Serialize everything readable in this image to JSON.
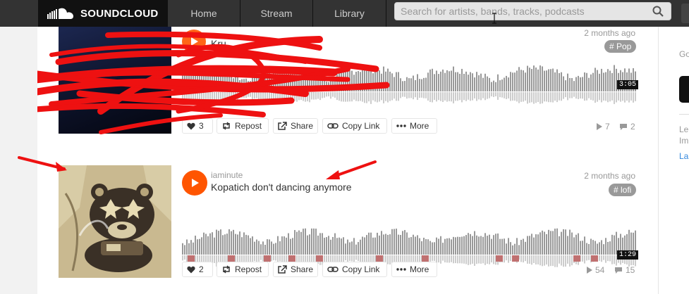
{
  "header": {
    "logo_text": "SOUNDCLOUD",
    "nav": [
      "Home",
      "Stream",
      "Library"
    ],
    "search_placeholder": "Search for artists, bands, tracks, podcasts"
  },
  "colors": {
    "accent": "#ff5500",
    "annotation": "#ee1111"
  },
  "tracks": [
    {
      "title": "Kru...",
      "posted": "2 months ago",
      "tag": "# Pop",
      "duration": "3:05",
      "likes": "3",
      "plays": "7",
      "comments": "2"
    },
    {
      "artist": "iaminute",
      "title": "Kopatich don't dancing anymore",
      "posted": "2 months ago",
      "tag": "# lofi",
      "duration": "1:29",
      "likes": "2",
      "plays": "54",
      "comments": "15"
    }
  ],
  "actions": {
    "repost": "Repost",
    "share": "Share",
    "copy_link": "Copy Link",
    "more": "More"
  },
  "sidebar": {
    "heading": "Go",
    "line1": "Le",
    "line2": "Im",
    "link": "La"
  },
  "icons": [
    "soundcloud-logo-icon",
    "search-icon",
    "play-icon",
    "heart-icon",
    "repost-icon",
    "share-icon",
    "link-icon",
    "more-icon",
    "play-count-icon",
    "comment-icon"
  ]
}
